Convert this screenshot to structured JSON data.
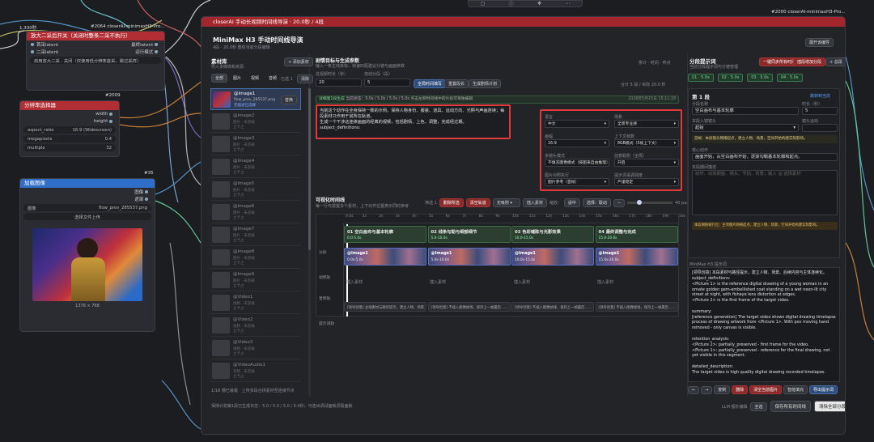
{
  "colors": {
    "accent_red": "#a3262d",
    "accent_green": "#3e6b47",
    "accent_blue": "#3a64c8",
    "canvas_bg": "#1b1d21"
  },
  "top_toolbar": {
    "icons": [
      "layout-icon",
      "info-icon",
      "move-icon",
      "more-icon"
    ]
  },
  "canvas": {
    "label_1330": "1,330秒",
    "node_2064": {
      "id": "#2064 closerAI-minimaxH3-Pro...",
      "title": "放大二采后开关（关闭时整条二采不执行）",
      "in1": "首采latent",
      "in2": "二采latent",
      "out1": "最终latent",
      "out2": "运行模式",
      "mode_text": "启用放大二采 · 关闭（仅使用低分辨率首采，跳过采样）"
    },
    "node_2009": {
      "id": "#2009",
      "title": "分辨率选择器",
      "out1": "width",
      "out2": "height",
      "w_aspect_label": "aspect_ratio",
      "w_aspect_value": "16:9 (Widescreen)",
      "w_mp_label": "megapixels",
      "w_mp_value": "0.4",
      "w_mult_label": "multiple",
      "w_mult_value": "32"
    },
    "node_35": {
      "id": "#35",
      "title": "加载图像",
      "out1": "图像",
      "out2": "遮罩",
      "w_image_label": "图像",
      "w_image_value": "flow_prev_285537.png",
      "upload": "选择文件上传",
      "img_size": "1376 × 768"
    },
    "node_2000_id": "#2000 closerAI-minimaxH3-Pro..."
  },
  "main": {
    "titlebar": "closerAI 手动长视频时间线导演 · 20.0秒 / 4段",
    "title": "MiniMax H3 手动时间线导演",
    "subtitle": "4段 · 20.0秒   整体当前分段编辑",
    "expand_btn": "展开该编导",
    "left": {
      "heading": "素材库",
      "sub": "导入多媒体和资源",
      "add_btn": "+ 添加素材",
      "tabs": [
        "全部",
        "图片",
        "视频",
        "音频"
      ],
      "filter": "已选 1",
      "clear_btn": "清除",
      "assets": [
        {
          "name": "@Image1",
          "file": "flow_prev_285537.png",
          "note": "无描述已选择",
          "active": true
        },
        {
          "name": "@Image2",
          "file": "图片 · 未装载",
          "note": "立卡占"
        },
        {
          "name": "@Image3",
          "file": "图片 · 未装载",
          "note": "立卡占"
        },
        {
          "name": "@Image4",
          "file": "图片 · 未装载",
          "note": "立卡占"
        },
        {
          "name": "@Image5",
          "file": "图片 · 未装载",
          "note": "立卡占"
        },
        {
          "name": "@Image6",
          "file": "图片 · 未装载",
          "note": "立卡占"
        },
        {
          "name": "@Image7",
          "file": "图片 · 未装载",
          "note": "立卡占"
        },
        {
          "name": "@Image8",
          "file": "图片 · 未装载",
          "note": "立卡占"
        },
        {
          "name": "@Image9",
          "file": "图片 · 未装载",
          "note": "立卡占"
        },
        {
          "name": "@Video1",
          "file": "视频 · 未装载",
          "note": "立卡占"
        },
        {
          "name": "@Video2",
          "file": "视频 · 未装载",
          "note": "立卡占"
        },
        {
          "name": "@Video3",
          "file": "视频 · 未装载",
          "note": "立卡占"
        },
        {
          "name": "@VideoAudio1",
          "file": "音频 · 未装载",
          "note": "立卡占"
        }
      ],
      "footer": "1/18 槽已装载 · 上传多段合拼素材至连接节点"
    },
    "center": {
      "heading": "剧情目标与生成参数",
      "sub": "输入一条主线目标，快速匹配建议分镜与画面参数",
      "legend": [
        "累计",
        "时间",
        "终点"
      ],
      "dur_label": "总视频时长（秒）",
      "dur_value": "20",
      "seg_label": "自动分段（段）",
      "seg_value": "5",
      "btn_fill": "全局时间填写",
      "btn_reset": "重置段长",
      "btn_plan": "生成剧情计划",
      "summary": "合计 5 段 / 实际 20.0 秒",
      "gen_label": "详细第1段生成",
      "gen_status": "当前状态：5.0s / 5.0s / 5.0s / 5.0s",
      "gen_note": "点击左侧时间线中的片段可单独编辑",
      "gen_time": "2026年5月15日 15:11:18",
      "prompt_lines": [
        "当前这个动作在全身保持一致的示例。保持人物身份、服装、道具、运动方向、光照与声画连续；每段素材只作用于其所在轨道。",
        "生成一个干涉这连续画面的经典的视频，包括剧情、上色、调整，完成经过期。",
        "subject_definitions:"
      ],
      "params": [
        {
          "k1": "语言",
          "v1": "中文",
          "k2": "场景",
          "v2": "全景专业感"
        },
        {
          "k1": "画幅",
          "v1": "16:9",
          "k2": "上下文帧数",
          "v2": "8GB模式（5帧上下文）"
        },
        {
          "k1": "多镜头模式",
          "v1": "不填充图像模式（按图来自由推理）",
          "k2": "创意联想（全局）",
          "v2": "开启"
        },
        {
          "k1": "图片对照执行",
          "v1": "图片参考（首帧）",
          "k2": "提示词语调强度",
          "v2": "严谨稳定"
        }
      ],
      "tl_heading": "可视化时间线",
      "tl_sub": "每一行可放置多个素材，上下对齐位置表示同时参考",
      "tl_filter_label": "筛选 1",
      "tl_btn1": "删除所选",
      "tl_btn2": "清空轨道",
      "tl_snap": "无吸附",
      "tl_btn3": "插入素材",
      "tl_zoom_label": "缩放：",
      "tl_zoom": "适中",
      "tl_mode": "选择：联动",
      "tl_px": "40 px/s",
      "tl_fit": "全部",
      "ruler": [
        "0.0s",
        "1s",
        "2s",
        "3s",
        "4s",
        "5s",
        "6s",
        "7s",
        "8s",
        "9s",
        "10s",
        "11s",
        "12s",
        "13s",
        "14s",
        "15s",
        "16s",
        "17s",
        "18s",
        "19s",
        "20s"
      ],
      "tracks": [
        "分段",
        "视频轨",
        "音频轨",
        "提示词轨"
      ],
      "segments": [
        {
          "title": "01 空白画布与基本轮廓",
          "range": "0.0-5.0s"
        },
        {
          "title": "02 线条勾勒与细部细节",
          "range": "5.0-10.0s"
        },
        {
          "title": "03 色彩铺陈与光影效果",
          "range": "10.0-15.0s"
        },
        {
          "title": "04 最终调整与完成",
          "range": "15.0-20.0s"
        }
      ],
      "video_clips": [
        {
          "name": "@Image1",
          "range": "0.0s-5.0s"
        },
        {
          "name": "@Image1",
          "range": "5.0s-10.0s"
        },
        {
          "name": "@Image1",
          "range": "10.0s-15.0s"
        },
        {
          "name": "@Image1",
          "range": "15.0s-20.0s"
        }
      ],
      "audio_hint": "插入素材",
      "hints": [
        "[领导创意] 主线素材与路径提示，建立人物、场景……",
        "[领导创意] 不插入图像帧线，保持上一帧最后……",
        "[领导创意] 不插入图像帧线，保持上一帧最后……",
        "[领导创意] 不插入图像帧线，保持上一帧最后……"
      ],
      "footer": "保持计划第1段已生成日志：5.0 / 5.0 / 5.0 / 5.0秒；可连出调试面板调看面板"
    },
    "right": {
      "heading": "分段提示词",
      "sub": "当前分段提示词与分镜管理",
      "btn_sync": "一键同步所有时间",
      "btn_split": "插段增加分段",
      "btn_add": "+ 总段",
      "chips": [
        "01 · 5.0s",
        "02 · 5.0s",
        "03 · 5.0s",
        "04 · 5.0s"
      ],
      "seg_title": "第 1 段",
      "seg_link": "跳转到当前",
      "name_label": "分段名称",
      "name_value": "空白画布与基本轮廓",
      "dur_label": "时长（秒）",
      "dur_value": "5",
      "scene_label": "本段入镜镜头",
      "scene_value": "起始",
      "cam_label": "镜头运动",
      "cam_value": "",
      "hint_text": "首帧：本段镜头网络起点，建立人物、场景，空间开始构建实际影响。",
      "act_label": "核心动作",
      "act_value": "画面开始，从空白画布开始，逐渐勾勒基本轮廓和起点。",
      "extra_label": "本段期间描述",
      "extra_placeholder": "动作、动效期望、镜头、节拍、背景；输入 @ 选择素材",
      "tip": "本段网格帧行位：主项图片网格起点，建立人物、场景，空间开始构建实际影响。",
      "preview_label": "MiniMax H3 提示词",
      "preview_lines": [
        "[领导创意] 本段素材与路径提示，建立人物、场景、后续内容与主体连续化。",
        "subject_definitions:",
        "<Picture 1> is the reference digital drawing of a young woman in an ornate golden gem-embellished coat standing on a wet neon-lit city street at night, with fisheye lens distortion at edges.",
        "<Picture 2> is the first frame of the target video.",
        "",
        "summary:",
        "[reference generation] The target video shows digital drawing timelapse process of drawing artwork from <Picture 1>. With pov moving hand removed - only canvas is visible.",
        "",
        "retention_analysis:",
        "<Picture 2>: partially_preserved - first frame for the video.",
        "<Picture 1>: partially_preserved - reference for the final drawing, not yet visible in this segment.",
        "",
        "detailed_description:",
        "The target video is high quality digital drawing recorded timelapse."
      ],
      "nav_prev": "←",
      "nav_next": "→",
      "b_copy": "复制",
      "b_del": "删除",
      "b_reset": "清空当前图片",
      "b_fill": "智能填充",
      "b_apply": "导出提示词"
    },
    "footer_right": {
      "llm": "LLM 额外编辑",
      "btn_small": "全选",
      "save": "保存所有时间线",
      "clear": "清除全部分段"
    }
  }
}
